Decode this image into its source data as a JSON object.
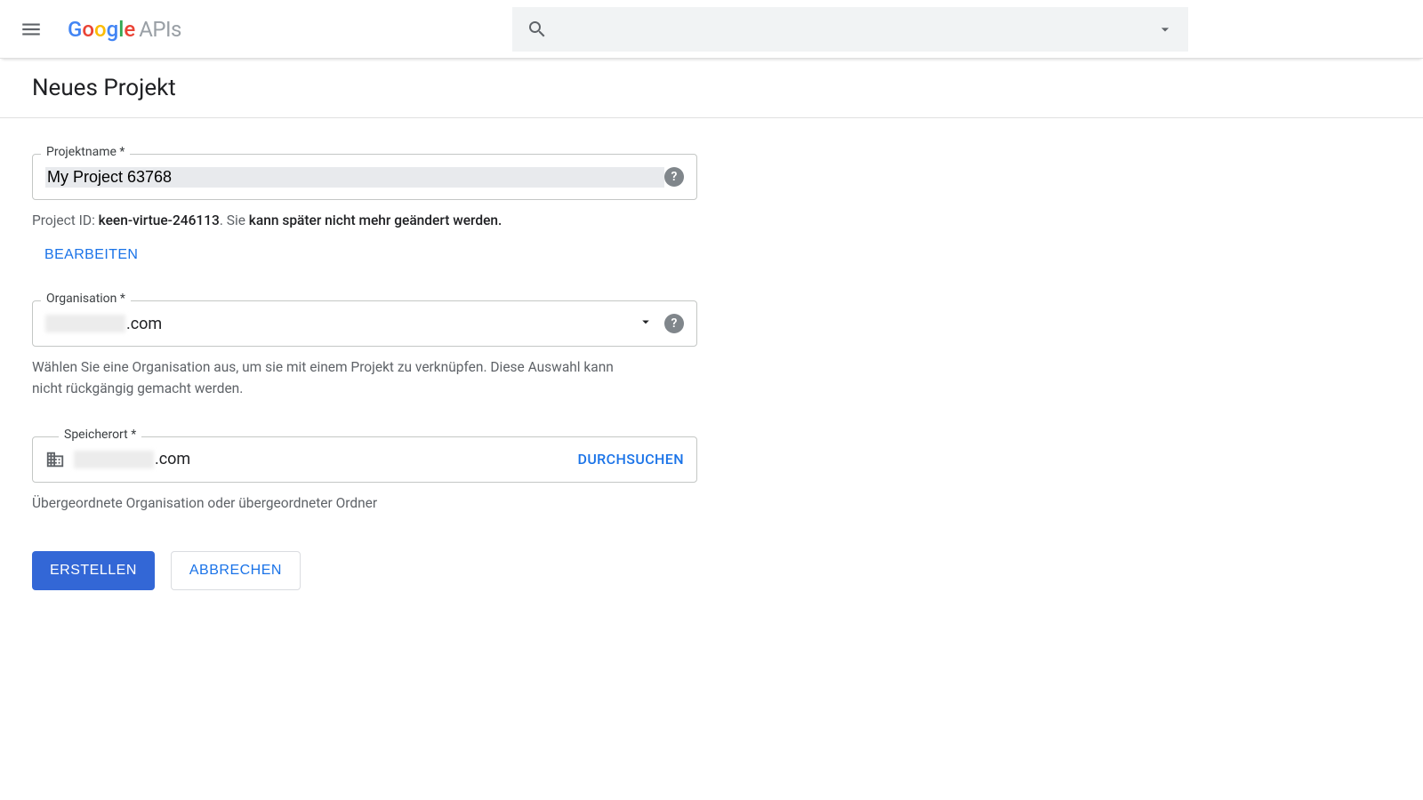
{
  "header": {
    "logo": {
      "brand": "Google",
      "product": "APIs"
    },
    "search": {
      "placeholder": ""
    }
  },
  "page": {
    "title": "Neues Projekt"
  },
  "form": {
    "projectName": {
      "label": "Projektname *",
      "value": "My Project 63768",
      "hint_id_label": "Project ID: ",
      "hint_id_value": "keen-virtue-246113",
      "hint_dot": ". ",
      "hint_rest_pre": "Sie ",
      "hint_rest": "kann später nicht mehr geändert werden.",
      "editLabel": "BEARBEITEN"
    },
    "organisation": {
      "label": "Organisation *",
      "value_suffix": ".com",
      "hint": "Wählen Sie eine Organisation aus, um sie mit einem Projekt zu verknüpfen. Diese Auswahl kann nicht rückgängig gemacht werden."
    },
    "location": {
      "label": "Speicherort *",
      "value_suffix": ".com",
      "browseLabel": "DURCHSUCHEN",
      "hint": "Übergeordnete Organisation oder übergeordneter Ordner"
    }
  },
  "buttons": {
    "create": "ERSTELLEN",
    "cancel": "ABBRECHEN"
  }
}
